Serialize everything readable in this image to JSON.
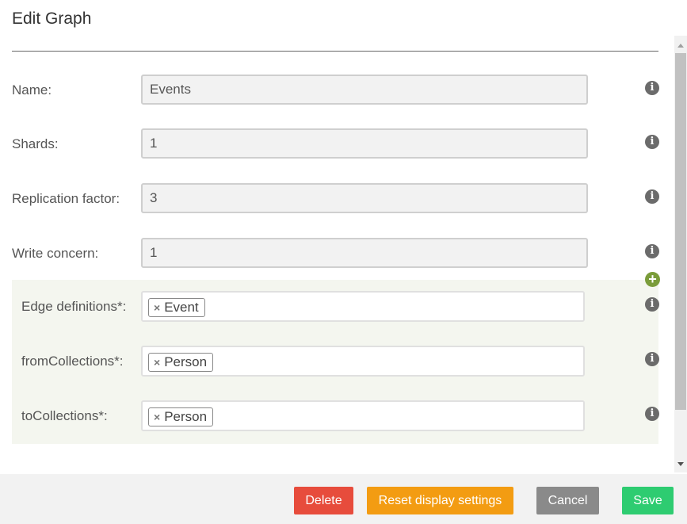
{
  "dialog": {
    "title": "Edit Graph"
  },
  "fields": {
    "name": {
      "label": "Name:",
      "value": "Events"
    },
    "shards": {
      "label": "Shards:",
      "value": "1"
    },
    "replication_factor": {
      "label": "Replication factor:",
      "value": "3"
    },
    "write_concern": {
      "label": "Write concern:",
      "value": "1"
    }
  },
  "edge_definition": {
    "edge_definitions": {
      "label": "Edge definitions*:",
      "tags": [
        "Event"
      ]
    },
    "from_collections": {
      "label": "fromCollections*:",
      "tags": [
        "Person"
      ]
    },
    "to_collections": {
      "label": "toCollections*:",
      "tags": [
        "Person"
      ]
    }
  },
  "icons": {
    "info": "i",
    "add": "+",
    "remove_tag": "×"
  },
  "footer": {
    "delete_label": "Delete",
    "reset_label": "Reset display settings",
    "cancel_label": "Cancel",
    "save_label": "Save"
  },
  "colors": {
    "delete": "#e74c3c",
    "reset": "#f39c12",
    "cancel": "#8a8a8a",
    "save": "#2ecc71",
    "add_icon": "#7a9c3a",
    "edge_panel_bg": "#f4f6ef"
  }
}
